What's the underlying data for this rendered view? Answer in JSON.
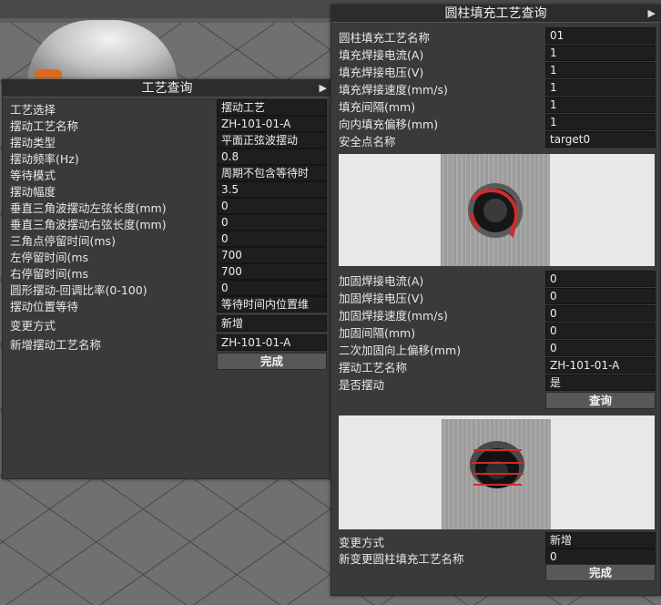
{
  "left_panel": {
    "title": "工艺查询",
    "rows": [
      {
        "label": "工艺选择",
        "value": "摆动工艺"
      },
      {
        "label": "摆动工艺名称",
        "value": "ZH-101-01-A"
      },
      {
        "label": "摆动类型",
        "value": "平面正弦波摆动"
      },
      {
        "label": "摆动频率(Hz)",
        "value": "0.8"
      },
      {
        "label": "等待模式",
        "value": "周期不包含等待时"
      },
      {
        "label": "摆动幅度",
        "value": "3.5"
      },
      {
        "label": "垂直三角波摆动左弦长度(mm)",
        "value": "0"
      },
      {
        "label": "垂直三角波摆动右弦长度(mm)",
        "value": "0"
      },
      {
        "label": "三角点停留时间(ms)",
        "value": "0"
      },
      {
        "label": "左停留时间(ms",
        "value": "700"
      },
      {
        "label": "右停留时间(ms",
        "value": "700"
      },
      {
        "label": "圆形摆动-回调比率(0-100)",
        "value": "0"
      },
      {
        "label": "摆动位置等待",
        "value": "等待时间内位置维"
      },
      {
        "label": "变更方式",
        "value": "新增"
      },
      {
        "label": "新增摆动工艺名称",
        "value": "ZH-101-01-A"
      }
    ],
    "done_button": "完成"
  },
  "right_panel": {
    "title": "圆柱填充工艺查询",
    "rows_top": [
      {
        "label": "圆柱填充工艺名称",
        "value": "01"
      },
      {
        "label": "填充焊接电流(A)",
        "value": "1"
      },
      {
        "label": "填充焊接电压(V)",
        "value": "1"
      },
      {
        "label": "填充焊接速度(mm/s)",
        "value": "1"
      },
      {
        "label": "填充间隔(mm)",
        "value": "1"
      },
      {
        "label": "向内填充偏移(mm)",
        "value": "1"
      },
      {
        "label": "安全点名称",
        "value": "target0"
      }
    ],
    "rows_mid": [
      {
        "label": "加固焊接电流(A)",
        "value": "0"
      },
      {
        "label": "加固焊接电压(V)",
        "value": "0"
      },
      {
        "label": "加固焊接速度(mm/s)",
        "value": "0"
      },
      {
        "label": "加固间隔(mm)",
        "value": "0"
      },
      {
        "label": "二次加固向上偏移(mm)",
        "value": "0"
      },
      {
        "label": "摆动工艺名称",
        "value": "ZH-101-01-A"
      },
      {
        "label": "是否摆动",
        "value": "是"
      }
    ],
    "query_button": "查询",
    "rows_bottom": [
      {
        "label": "变更方式",
        "value": "新增"
      },
      {
        "label": "新变更圆柱填充工艺名称",
        "value": "0"
      }
    ],
    "done_button": "完成"
  },
  "colors": {
    "panel_bg": "#3a3a3a",
    "field_bg": "#1e1e1e",
    "weld_red": "#d42a2a"
  }
}
